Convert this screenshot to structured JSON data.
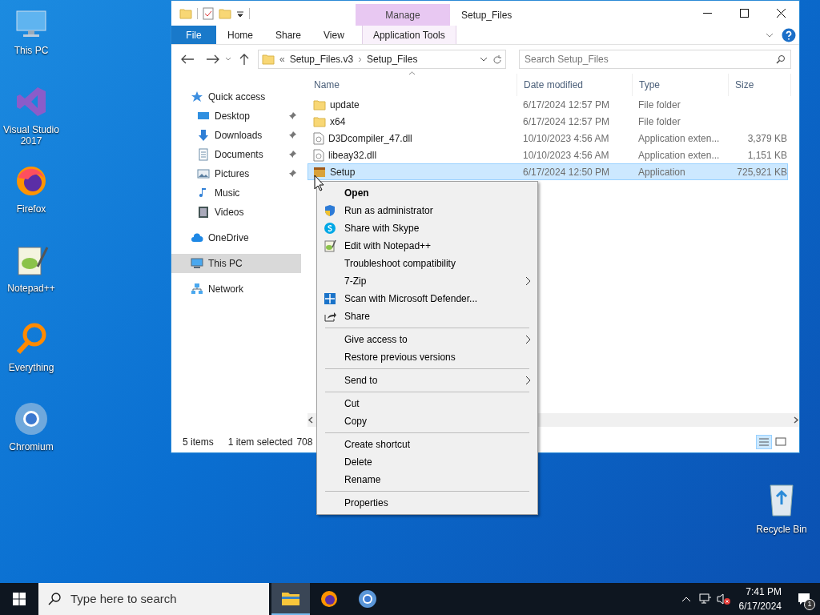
{
  "desktop_icons": [
    {
      "label": "This PC",
      "kind": "pc"
    },
    {
      "label": "Visual Studio 2017",
      "kind": "vs"
    },
    {
      "label": "Firefox",
      "kind": "firefox"
    },
    {
      "label": "Notepad++",
      "kind": "notepad"
    },
    {
      "label": "Everything",
      "kind": "everything"
    },
    {
      "label": "Chromium",
      "kind": "chromium"
    }
  ],
  "recycle_bin": {
    "label": "Recycle Bin"
  },
  "window": {
    "title": "Setup_Files",
    "context_tab": "Manage",
    "ribbon_tabs": [
      {
        "label": "File",
        "kind": "file",
        "selected": false
      },
      {
        "label": "Home",
        "kind": "tab",
        "selected": false
      },
      {
        "label": "Share",
        "kind": "tab",
        "selected": false
      },
      {
        "label": "View",
        "kind": "tab",
        "selected": false
      },
      {
        "label": "Application Tools",
        "kind": "context",
        "selected": false
      }
    ],
    "address": {
      "overflow": "«",
      "crumbs": [
        "Setup_Files.v3",
        "Setup_Files"
      ]
    },
    "search": {
      "placeholder": "Search Setup_Files"
    },
    "nav": [
      {
        "label": "Quick access",
        "kind": "star",
        "pinned": false,
        "selected": false
      },
      {
        "label": "Desktop",
        "kind": "desktop",
        "pinned": true,
        "selected": false
      },
      {
        "label": "Downloads",
        "kind": "download",
        "pinned": true,
        "selected": false
      },
      {
        "label": "Documents",
        "kind": "documents",
        "pinned": true,
        "selected": false
      },
      {
        "label": "Pictures",
        "kind": "pictures",
        "pinned": true,
        "selected": false
      },
      {
        "label": "Music",
        "kind": "music",
        "pinned": false,
        "selected": false
      },
      {
        "label": "Videos",
        "kind": "videos",
        "pinned": false,
        "selected": false
      },
      {
        "label": "OneDrive",
        "kind": "cloud",
        "pinned": false,
        "selected": false
      },
      {
        "label": "This PC",
        "kind": "pc",
        "pinned": false,
        "selected": true
      },
      {
        "label": "Network",
        "kind": "network",
        "pinned": false,
        "selected": false
      }
    ],
    "columns": [
      "Name",
      "Date modified",
      "Type",
      "Size"
    ],
    "files": [
      {
        "name": "update",
        "date": "6/17/2024 12:57 PM",
        "type": "File folder",
        "kind": "folder",
        "selected": false
      },
      {
        "name": "x64",
        "date": "6/17/2024 12:57 PM",
        "type": "File folder",
        "kind": "folder",
        "selected": false
      },
      {
        "name": "D3Dcompiler_47.dll",
        "date": "10/10/2023 4:56 AM",
        "type": "Application exten...",
        "size": "3,379 KB",
        "kind": "dll",
        "selected": false
      },
      {
        "name": "libeay32.dll",
        "date": "10/10/2023 4:56 AM",
        "type": "Application exten...",
        "size": "1,151 KB",
        "kind": "dll",
        "selected": false
      },
      {
        "name": "Setup",
        "date": "6/17/2024 12:50 PM",
        "type": "Application",
        "size": "725,921 KB",
        "kind": "app",
        "selected": true
      }
    ],
    "status": {
      "count": "5 items",
      "selection": "1 item selected",
      "size": "708"
    }
  },
  "context_menu": [
    {
      "kind": "plain",
      "label": "Open",
      "bold": true,
      "submenu": false
    },
    {
      "kind": "shield",
      "label": "Run as administrator",
      "bold": false,
      "submenu": false
    },
    {
      "kind": "skype",
      "label": "Share with Skype",
      "bold": false,
      "submenu": false
    },
    {
      "kind": "notepad",
      "label": "Edit with Notepad++",
      "bold": false,
      "submenu": false
    },
    {
      "kind": "plain",
      "label": "Troubleshoot compatibility",
      "bold": false,
      "submenu": false
    },
    {
      "kind": "plain",
      "label": "7-Zip",
      "bold": false,
      "submenu": true
    },
    {
      "kind": "defender",
      "label": "Scan with Microsoft Defender...",
      "bold": false,
      "submenu": false
    },
    {
      "kind": "share",
      "label": "Share",
      "bold": false,
      "submenu": false
    },
    {
      "kind": "separator"
    },
    {
      "kind": "plain",
      "label": "Give access to",
      "bold": false,
      "submenu": true
    },
    {
      "kind": "plain",
      "label": "Restore previous versions",
      "bold": false,
      "submenu": false
    },
    {
      "kind": "separator"
    },
    {
      "kind": "plain",
      "label": "Send to",
      "bold": false,
      "submenu": true
    },
    {
      "kind": "separator"
    },
    {
      "kind": "plain",
      "label": "Cut",
      "bold": false,
      "submenu": false
    },
    {
      "kind": "plain",
      "label": "Copy",
      "bold": false,
      "submenu": false
    },
    {
      "kind": "separator"
    },
    {
      "kind": "plain",
      "label": "Create shortcut",
      "bold": false,
      "submenu": false
    },
    {
      "kind": "plain",
      "label": "Delete",
      "bold": false,
      "submenu": false
    },
    {
      "kind": "plain",
      "label": "Rename",
      "bold": false,
      "submenu": false
    },
    {
      "kind": "separator"
    },
    {
      "kind": "plain",
      "label": "Properties",
      "bold": false,
      "submenu": false
    }
  ],
  "taskbar": {
    "search_placeholder": "Type here to search",
    "apps": [
      {
        "kind": "explorer",
        "selected": true
      },
      {
        "kind": "firefox",
        "selected": false
      },
      {
        "kind": "chromium",
        "selected": false
      }
    ],
    "time": "7:41 PM",
    "date": "6/17/2024",
    "notifications": "1"
  }
}
